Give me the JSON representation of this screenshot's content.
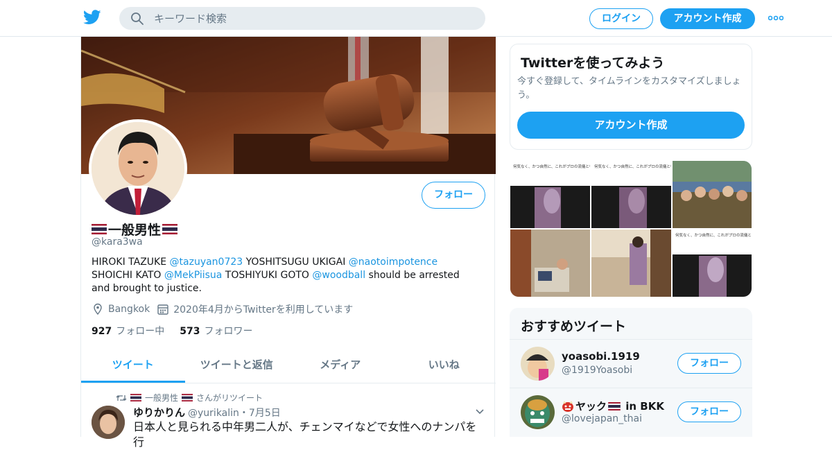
{
  "header": {
    "logo_icon": "twitter-bird-icon",
    "search_placeholder": "キーワード検索",
    "login_label": "ログイン",
    "signup_label": "アカウント作成",
    "more_icon": "more-dots-icon",
    "brand_color": "#1da1f2"
  },
  "profile": {
    "follow_label": "フォロー",
    "display_name": "一般男性",
    "name_flag": "thailand-flag-icon",
    "handle": "@kara3wa",
    "bio": {
      "t1": "HIROKI TAZUKE ",
      "m1": "@tazuyan0723",
      "t2": " YOSHITSUGU UKIGAI ",
      "m2": "@naotoimpotence",
      "t3": " SHOICHI KATO ",
      "m3": "@MekPiisua",
      "t4": " TOSHIYUKI GOTO ",
      "m4": "@woodball",
      "t5": " should be arrested and brought to justice."
    },
    "location": "Bangkok",
    "joined": "2020年4月からTwitterを利用しています",
    "following_count": "927",
    "following_label": "フォロー中",
    "followers_count": "573",
    "followers_label": "フォロワー"
  },
  "tabs": [
    {
      "label": "ツイート",
      "active": true
    },
    {
      "label": "ツイートと返信",
      "active": false
    },
    {
      "label": "メディア",
      "active": false
    },
    {
      "label": "いいね",
      "active": false
    }
  ],
  "tweet": {
    "retweeter": "一般男性",
    "retweet_suffix": "さんがリツイート",
    "author_name": "ゆりかりん",
    "author_handle": "@yurikalin",
    "date": "・7月5日",
    "text": "日本人と見られる中年男二人が、チェンマイなどで女性へのナンパを行"
  },
  "signup_card": {
    "title": "Twitterを使ってみよう",
    "text": "今すぐ登録して、タイムラインをカスタマイズしましょう。",
    "button": "アカウント作成"
  },
  "media": [
    {
      "caption": "何気なく、かつ自然に、これがプロの流儀というものでしょう。さすがですwww"
    },
    {
      "caption": "何気なく、かつ自然に、これがプロの流儀というものでしょう。さすがですwww"
    },
    {
      "caption": ""
    },
    {
      "caption": ""
    },
    {
      "caption": ""
    },
    {
      "caption": "何気なく、かつ自然に、これがプロの流儀というものでしょう。さすがですwww"
    }
  ],
  "recommended": {
    "title": "おすすめツイート",
    "items": [
      {
        "name": "yoasobi.1919",
        "handle": "@1919Yoasobi",
        "follow": "フォロー"
      },
      {
        "name_prefix": "ヤック",
        "name_suffix": " in BKK",
        "handle": "@lovejapan_thai",
        "follow": "フォロー"
      }
    ]
  }
}
